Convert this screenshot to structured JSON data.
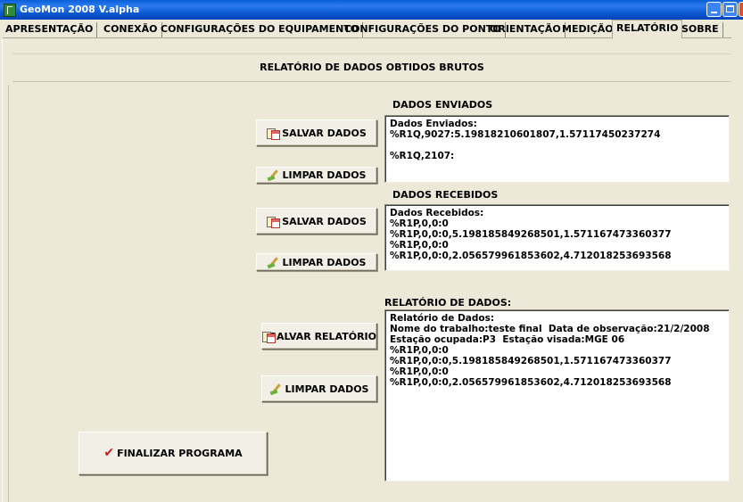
{
  "window": {
    "title": "GeoMon 2008 V.alpha",
    "icon": "app-icon"
  },
  "tabs": [
    {
      "label": "APRESENTAÇÃO"
    },
    {
      "label": "CONEXÃO"
    },
    {
      "label": "CONFIGURAÇÕES DO EQUIPAMENTO"
    },
    {
      "label": "CONFIGURAÇÕES DO PONTO"
    },
    {
      "label": "ORIENTAÇÃO"
    },
    {
      "label": "MEDIÇÃO"
    },
    {
      "label": "RELATÓRIO",
      "active": true
    },
    {
      "label": "SOBRE"
    }
  ],
  "header": {
    "title": "RELATÓRIO DE DADOS OBTIDOS BRUTOS"
  },
  "sent": {
    "label": "DADOS ENVIADOS",
    "save_label": "SALVAR DADOS",
    "clear_label": "LIMPAR DADOS",
    "text": "Dados Enviados:\n%R1Q,9027:5.19818210601807,1.57117450237274\n\n%R1Q,2107:"
  },
  "received": {
    "label": "DADOS RECEBIDOS",
    "save_label": "SALVAR DADOS",
    "clear_label": "LIMPAR DADOS",
    "text": "Dados Recebidos:\n%R1P,0,0:0\n%R1P,0,0:0,5.198185849268501,1.571167473360377\n%R1P,0,0:0\n%R1P,0,0:0,2.056579961853602,4.712018253693568"
  },
  "report": {
    "label": "RELATÓRIO DE DADOS:",
    "save_label": "SALVAR RELATÓRIO",
    "clear_label": "LIMPAR DADOS",
    "text": "Relatório de Dados:\nNome do trabalho:teste final  Data de observação:21/2/2008  Estação ocupada:P3  Estação visada:MGE 06\n%R1P,0,0:0\n%R1P,0,0:0,5.198185849268501,1.571167473360377\n%R1P,0,0:0\n%R1P,0,0:0,2.056579961853602,4.712018253693568"
  },
  "finish": {
    "label": "FINALIZAR PROGRAMA"
  }
}
